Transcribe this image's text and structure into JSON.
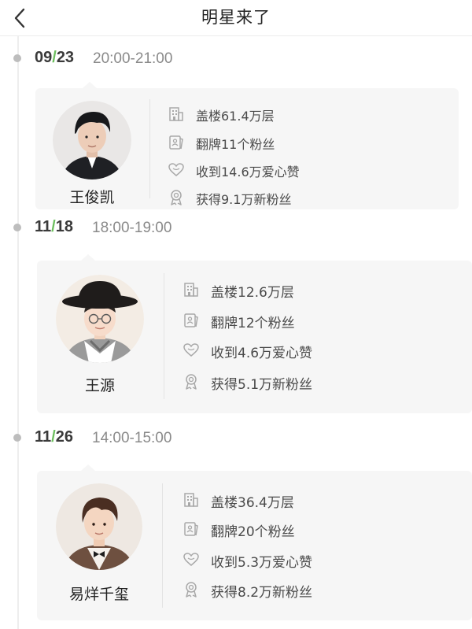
{
  "header": {
    "title": "明星来了"
  },
  "entries": [
    {
      "date_month": "09",
      "date_day": "23",
      "time": "20:00-21:00",
      "name": "王俊凯",
      "stats": [
        {
          "icon": "building-icon",
          "text": "盖楼61.4万层"
        },
        {
          "icon": "flip-card-icon",
          "text": "翻牌11个粉丝"
        },
        {
          "icon": "heart-icon",
          "text": "收到14.6万爱心赞"
        },
        {
          "icon": "medal-icon",
          "text": "获得9.1万新粉丝"
        }
      ]
    },
    {
      "date_month": "11",
      "date_day": "18",
      "time": "18:00-19:00",
      "name": "王源",
      "stats": [
        {
          "icon": "building-icon",
          "text": "盖楼12.6万层"
        },
        {
          "icon": "flip-card-icon",
          "text": "翻牌12个粉丝"
        },
        {
          "icon": "heart-icon",
          "text": "收到4.6万爱心赞"
        },
        {
          "icon": "medal-icon",
          "text": "获得5.1万新粉丝"
        }
      ]
    },
    {
      "date_month": "11",
      "date_day": "26",
      "time": "14:00-15:00",
      "name": "易烊千玺",
      "stats": [
        {
          "icon": "building-icon",
          "text": "盖楼36.4万层"
        },
        {
          "icon": "flip-card-icon",
          "text": "翻牌20个粉丝"
        },
        {
          "icon": "heart-icon",
          "text": "收到5.3万爱心赞"
        },
        {
          "icon": "medal-icon",
          "text": "获得8.2万新粉丝"
        }
      ]
    }
  ],
  "colors": {
    "accent_slash": "#6cbf5e",
    "card_bg": "#f6f6f6",
    "timeline_dot": "#bdbdbd"
  }
}
